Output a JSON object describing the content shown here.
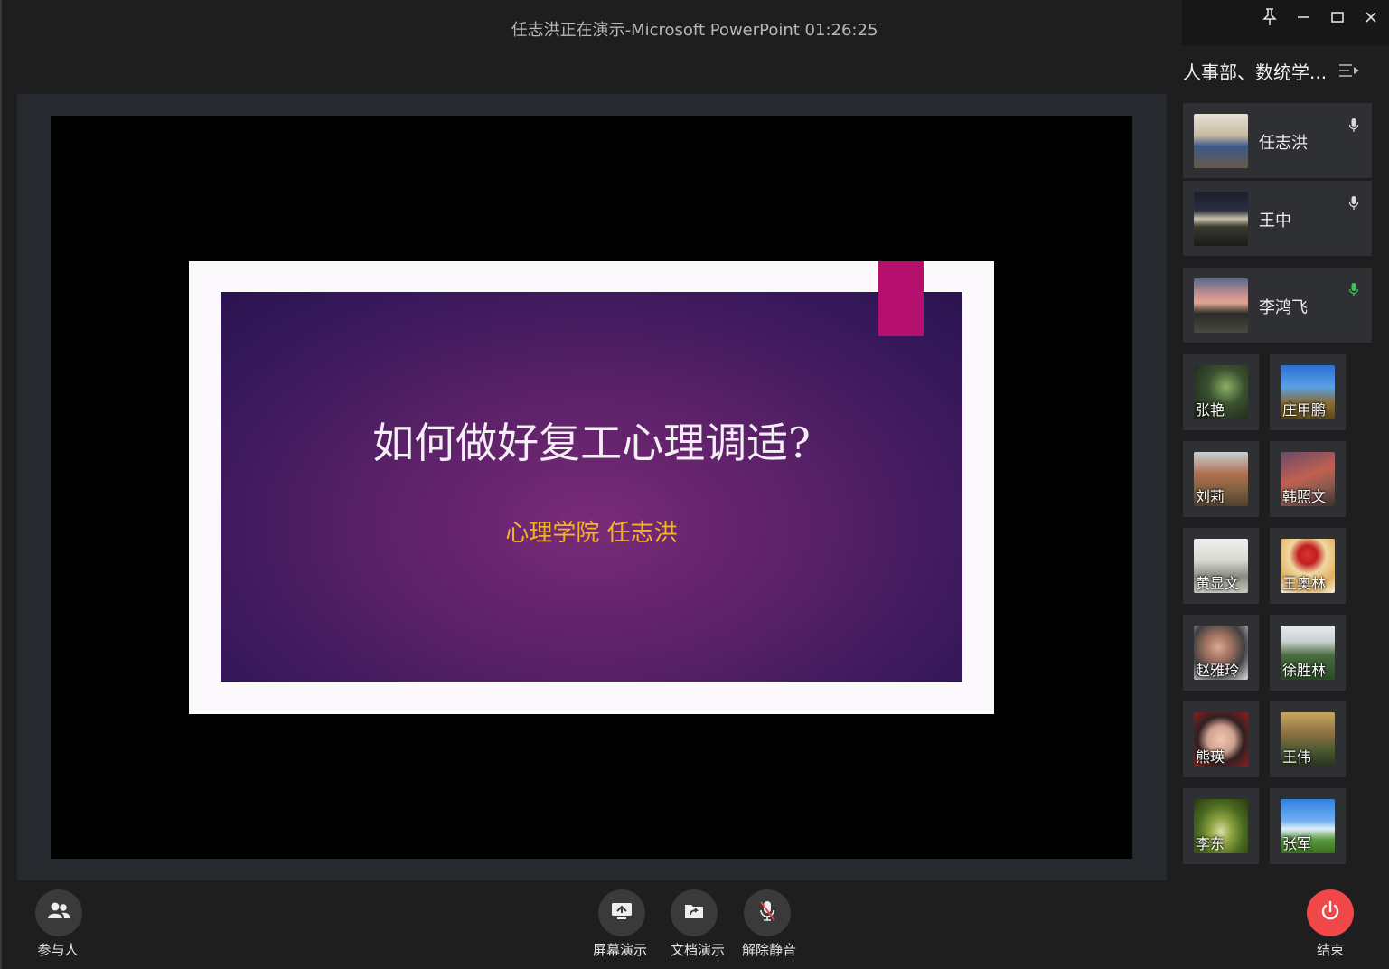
{
  "window": {
    "title": "任志洪正在演示-Microsoft PowerPoint 01:26:25"
  },
  "slide": {
    "title": "如何做好复工心理调适?",
    "subtitle": "心理学院 任志洪"
  },
  "sidebar": {
    "meeting_name": "人事部、数统学...",
    "featured": [
      {
        "name": "任志洪",
        "mic": "mic-icon",
        "mic_color": "#d9d9d9"
      },
      {
        "name": "王中",
        "mic": "mic-icon",
        "mic_color": "#d9d9d9"
      },
      {
        "name": "李鸿飞",
        "mic": "mic-active-icon",
        "mic_color": "#3cc35a"
      }
    ],
    "participants": [
      {
        "name": "张艳"
      },
      {
        "name": "庄甲鹏"
      },
      {
        "name": "刘莉"
      },
      {
        "name": "韩照文"
      },
      {
        "name": "黄显文"
      },
      {
        "name": "王奥林"
      },
      {
        "name": "赵雅玲"
      },
      {
        "name": "徐胜林"
      },
      {
        "name": "熊瑛"
      },
      {
        "name": "王伟"
      },
      {
        "name": "李东"
      },
      {
        "name": "张军"
      }
    ]
  },
  "toolbar": {
    "participants_label": "参与人",
    "screen_share_label": "屏幕演示",
    "doc_share_label": "文档演示",
    "unmute_label": "解除静音",
    "end_label": "结束"
  },
  "colors": {
    "end_button": "#f04848",
    "slide_accent": "#b5106d",
    "subtitle": "#f3b425"
  }
}
